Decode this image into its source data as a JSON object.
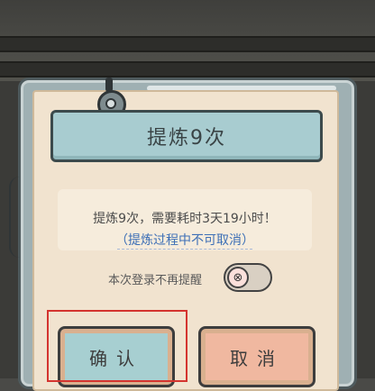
{
  "dialog": {
    "title": "提炼9次",
    "message": "提炼9次，需要耗时3天19小时！",
    "warning": "（提炼过程中不可取消）",
    "remember_label": "本次登录不再提醒",
    "toggle_state": "off",
    "toggle_glyph": "⊗",
    "confirm_label": "确认",
    "cancel_label": "取消"
  },
  "colors": {
    "title_bg": "#a8ccd0",
    "confirm_bg": "#a7cfd1",
    "cancel_bg": "#f0b8a0",
    "panel_bg": "#f1e3cf",
    "warning_text": "#3d6fb6",
    "highlight_border": "#d4342f"
  },
  "icons": {
    "knob": "frame-knob-icon",
    "toggle": "toggle-x-icon"
  }
}
